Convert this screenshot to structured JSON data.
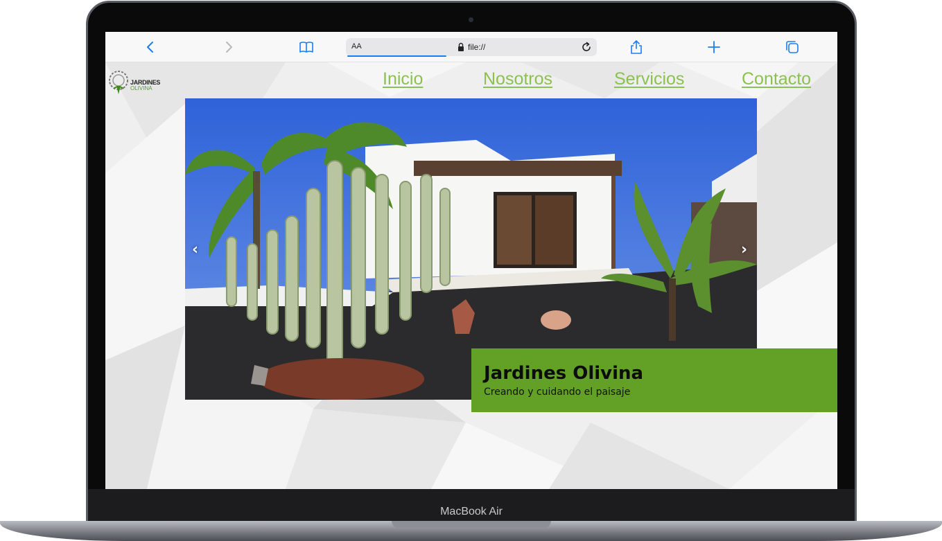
{
  "device": {
    "model_label": "MacBook Air"
  },
  "browser": {
    "text_size_label": "AA",
    "url": "file://",
    "icons": [
      "back-icon",
      "forward-icon",
      "bookmarks-icon",
      "lock-icon",
      "reload-icon",
      "share-icon",
      "new-tab-icon",
      "tabs-icon"
    ],
    "accent": "#1a7cf5"
  },
  "site": {
    "logo": {
      "line1": "JARDINES",
      "line2": "OLIVINA"
    },
    "nav": [
      {
        "label": "Inicio"
      },
      {
        "label": "Nosotros"
      },
      {
        "label": "Servicios"
      },
      {
        "label": "Contacto"
      }
    ],
    "carousel": {
      "prev_label": "‹",
      "next_label": "›"
    },
    "hero": {
      "title": "Jardines Olivina",
      "subtitle": "Creando y cuidando el paisaje"
    },
    "colors": {
      "nav_link": "#8cc152",
      "caption_bg": "#62a125"
    }
  }
}
